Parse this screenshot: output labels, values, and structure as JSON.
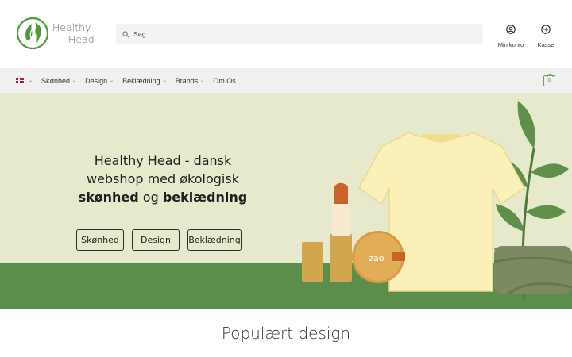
{
  "header": {
    "logo": {
      "line1": "Healthy",
      "line2": "Head",
      "icon": "leaf-face-logo"
    },
    "search": {
      "placeholder": "Søg...",
      "icon": "search-icon"
    },
    "account": {
      "label": "Min konto",
      "icon": "user-circle-icon"
    },
    "checkout": {
      "label": "Kasse",
      "icon": "arrow-right-circle-icon"
    }
  },
  "nav": {
    "language": {
      "flag": "danish-flag",
      "chevron": "⌄"
    },
    "items": [
      {
        "label": "Skønhed",
        "chevron": "⌄"
      },
      {
        "label": "Design",
        "chevron": "⌄"
      },
      {
        "label": "Beklædning",
        "chevron": "⌄"
      },
      {
        "label": "Brands",
        "chevron": "⌄"
      },
      {
        "label": "Om Os",
        "chevron": ""
      }
    ],
    "cart": {
      "count": "0",
      "icon": "shopping-bag-icon"
    }
  },
  "hero": {
    "title_line1": "Healthy Head - dansk",
    "title_line2": "webshop med økologisk",
    "title_bold1": "skønhed",
    "title_mid": " og ",
    "title_bold2": "beklædning",
    "buttons": [
      {
        "label": "Skønhed"
      },
      {
        "label": "Design"
      },
      {
        "label": "Beklædning"
      }
    ],
    "compact_label": "zao"
  },
  "section": {
    "title": "Populært design"
  },
  "colors": {
    "brand_green": "#6aa84f",
    "hero_bg": "#e6e9cb",
    "hero_ground": "#5b8e4a"
  }
}
